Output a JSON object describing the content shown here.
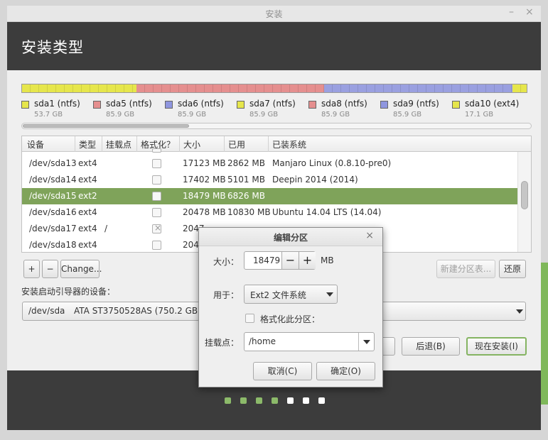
{
  "window": {
    "title": "安装",
    "minimize": "–",
    "close": "×"
  },
  "header": {
    "title": "安装类型"
  },
  "partition_bar": {
    "segments": [
      {
        "name": "sda1",
        "color": "#e6e64c",
        "fraction": 0.227
      },
      {
        "name": "sda5",
        "color": "#e58f8f",
        "fraction": 0.371
      },
      {
        "name": "sda6",
        "color": "#9aa0e0",
        "fraction": 0.374
      },
      {
        "name": "sda7",
        "color": "#e6e64c",
        "fraction": 0.028
      }
    ],
    "legend": [
      {
        "name": "sda1 (ntfs)",
        "size": "53.7 GB",
        "color": "#e6e64c"
      },
      {
        "name": "sda5 (ntfs)",
        "size": "85.9 GB",
        "color": "#e58f8f"
      },
      {
        "name": "sda6 (ntfs)",
        "size": "85.9 GB",
        "color": "#8f96df"
      },
      {
        "name": "sda7 (ntfs)",
        "size": "85.9 GB",
        "color": "#e6e64c"
      },
      {
        "name": "sda8 (ntfs)",
        "size": "85.9 GB",
        "color": "#e58f8f"
      },
      {
        "name": "sda9 (ntfs)",
        "size": "85.9 GB",
        "color": "#8f96df"
      },
      {
        "name": "sda10 (ext4)",
        "size": "17.1 GB",
        "color": "#e6e64c"
      }
    ]
  },
  "table": {
    "headers": [
      "设备",
      "类型",
      "挂载点",
      "格式化？",
      "大小",
      "已用",
      "已装系统"
    ],
    "rows": [
      {
        "device": "/dev/sda13",
        "type": "ext4",
        "mount": "",
        "format": false,
        "size": "17123 MB",
        "used": "2862 MB",
        "system": "Manjaro Linux (0.8.10-pre0)",
        "selected": false
      },
      {
        "device": "/dev/sda14",
        "type": "ext4",
        "mount": "",
        "format": false,
        "size": "17402 MB",
        "used": "5101 MB",
        "system": "Deepin 2014 (2014)",
        "selected": false
      },
      {
        "device": "/dev/sda15",
        "type": "ext2",
        "mount": "",
        "format": false,
        "size": "18479 MB",
        "used": "6826 MB",
        "system": "",
        "selected": true
      },
      {
        "device": "/dev/sda16",
        "type": "ext4",
        "mount": "",
        "format": false,
        "size": "20478 MB",
        "used": "10830 MB",
        "system": "Ubuntu 14.04 LTS (14.04)",
        "selected": false
      },
      {
        "device": "/dev/sda17",
        "type": "ext4",
        "mount": "/",
        "format": true,
        "size": "2047",
        "used": "",
        "system": "",
        "selected": false
      },
      {
        "device": "/dev/sda18",
        "type": "ext4",
        "mount": "",
        "format": false,
        "size": "204",
        "used": "",
        "system": "",
        "selected": false
      }
    ]
  },
  "toolbar": {
    "add": "+",
    "remove": "−",
    "change": "Change...",
    "new_table": "新建分区表...",
    "revert": "还原"
  },
  "bootloader": {
    "label": "安装启动引导器的设备：",
    "device": "/dev/sda",
    "model": "ATA ST3750528AS (750.2 GB)"
  },
  "actions": {
    "back": "后退(B)",
    "install": "现在安装(I)"
  },
  "progress_dots": {
    "total": 7,
    "completed": 4,
    "done_color": "#8cba6a",
    "todo_color": "#ffffff"
  },
  "dialog": {
    "title": "编辑分区",
    "close": "×",
    "size_label": "大小：",
    "size_value": "18479",
    "size_unit": "MB",
    "minus": "−",
    "plus": "+",
    "use_label": "用于：",
    "use_value": "Ext2 文件系统",
    "format_label": "格式化此分区：",
    "mount_label": "挂载点：",
    "mount_value": "/home",
    "cancel": "取消(C)",
    "ok": "确定(O)"
  }
}
